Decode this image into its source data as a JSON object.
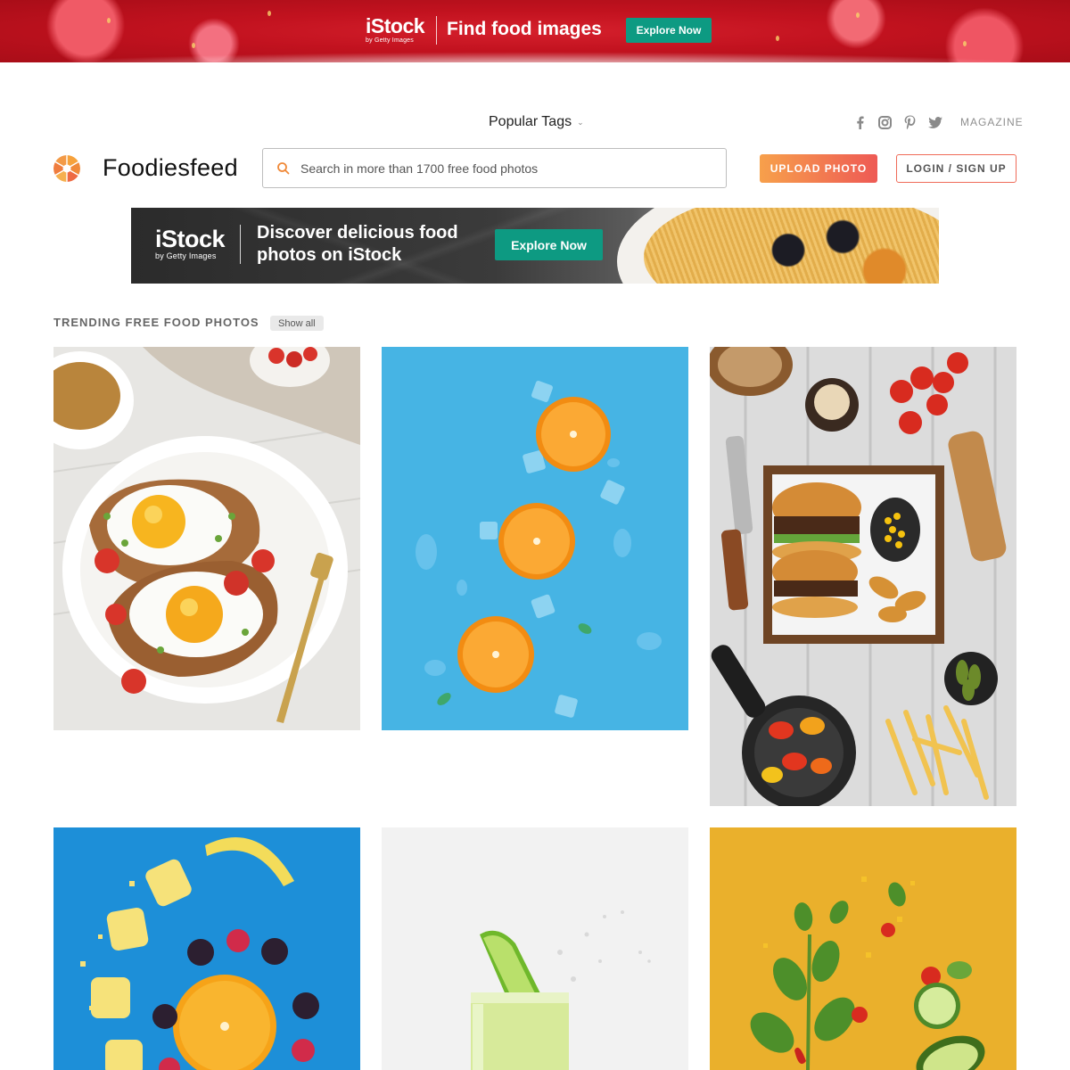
{
  "top_ad": {
    "logo_text": "iStock",
    "logo_sub": "by Getty Images",
    "headline": "Find food images",
    "cta": "Explore Now"
  },
  "header": {
    "popular_tags": "Popular Tags",
    "social": [
      "facebook-icon",
      "instagram-icon",
      "pinterest-icon",
      "twitter-icon"
    ],
    "magazine": "MAGAZINE",
    "brand": "Foodiesfeed",
    "search_placeholder": "Search in more than 1700 free food photos",
    "upload_button": "UPLOAD PHOTO",
    "login_button": "LOGIN / SIGN UP",
    "colors": {
      "accent_start": "#f7a04b",
      "accent_end": "#ee5a55",
      "istock_green": "#0d9a82"
    }
  },
  "mid_ad": {
    "logo_text": "iStock",
    "logo_sub": "by Getty Images",
    "headline": "Discover delicious food photos on iStock",
    "cta": "Explore Now"
  },
  "trending": {
    "title": "TRENDING FREE FOOD PHOTOS",
    "show_all": "Show all"
  }
}
